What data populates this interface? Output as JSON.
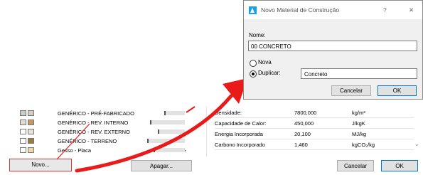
{
  "materials": [
    {
      "name": "GENÉRICO - PRÉ-FABRICADO",
      "color1": "#c9c9c9",
      "color2": "#d7cdc3",
      "bar": 0.55
    },
    {
      "name": "GENÉRICO - REV. INTERNO",
      "color1": "#e2dcc6",
      "color2": "#c69a5c",
      "bar": 0.22
    },
    {
      "name": "GENÉRICO - REV. EXTERNO",
      "color1": "#ffffff",
      "color2": "#e8e4d4",
      "bar": 0.4
    },
    {
      "name": "GENÉRICO - TERRENO",
      "color1": "#ffffff",
      "color2": "#9c7b3d",
      "bar": 0.15
    },
    {
      "name": "Gesso - Placa",
      "color1": "#ffffff",
      "color2": "#f0d9a8",
      "bar": 0.3
    }
  ],
  "left_buttons": {
    "novo": "Novo...",
    "apagar": "Apagar..."
  },
  "properties": [
    {
      "label": "Densidade:",
      "value": "7800,000",
      "unit": "kg/m³"
    },
    {
      "label": "Capacidade de Calor:",
      "value": "450,000",
      "unit": "J/kgK"
    },
    {
      "label": "Energia Incorporada",
      "value": "20,100",
      "unit": "MJ/kg"
    },
    {
      "label": "Carbono Incorporado",
      "value": "1,460",
      "unit": "kgCO₂/kg"
    }
  ],
  "main_buttons": {
    "cancel": "Cancelar",
    "ok": "OK"
  },
  "dialog": {
    "title": "Novo Material de Construção",
    "help": "?",
    "close": "✕",
    "name_label": "Nome:",
    "name_value": "00 CONCRETO",
    "option_new": "Nova",
    "option_duplicate": "Duplicar:",
    "duplicate_value": "Concreto",
    "cancel": "Cancelar",
    "ok": "OK"
  },
  "colors": {
    "arrow": "#e81a1a",
    "accent": "#0078d7",
    "app_icon": "#1ba1e2"
  }
}
